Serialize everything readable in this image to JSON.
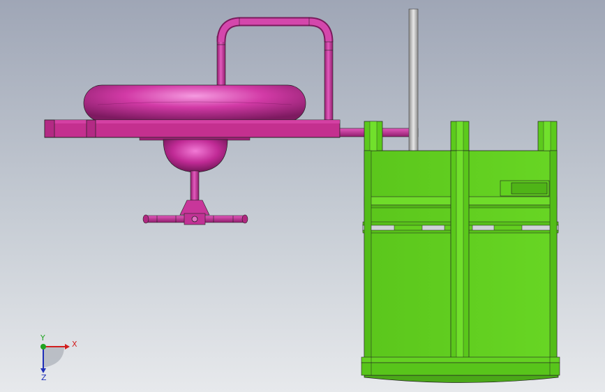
{
  "viewport": {
    "background_top": "#9fa6b6",
    "background_bottom": "#e7e9ec"
  },
  "colors": {
    "magenta": "#cc2f9e",
    "magenta_dark": "#8a1d6a",
    "magenta_light": "#ef74d0",
    "green": "#5fcd1e",
    "green_dark": "#3f8f12",
    "green_light": "#7fe838",
    "pipe_gray": "#b8b8b8",
    "outline": "#222222"
  },
  "triad": {
    "x_label": "X",
    "y_label": "Y",
    "z_label": "Z",
    "x_color": "#d21f1f",
    "y_color": "#1fa31f",
    "z_color": "#1f2fb8"
  },
  "icons": [
    "reference-triad-icon"
  ]
}
